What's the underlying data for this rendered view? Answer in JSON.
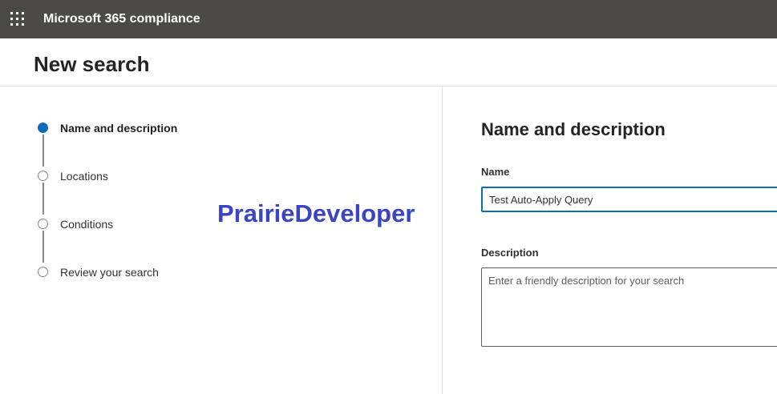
{
  "header": {
    "app_title": "Microsoft 365 compliance",
    "app_launcher_icon": "waffle-icon",
    "background_color": "#4b4a48"
  },
  "page": {
    "title": "New search"
  },
  "wizard": {
    "active_color": "#0f6cbd",
    "steps": [
      {
        "label": "Name and description",
        "state": "active"
      },
      {
        "label": "Locations",
        "state": "pending"
      },
      {
        "label": "Conditions",
        "state": "pending"
      },
      {
        "label": "Review your search",
        "state": "pending"
      }
    ]
  },
  "watermark": {
    "text": "PrairieDeveloper",
    "color": "#3b45c4"
  },
  "form": {
    "heading": "Name and description",
    "name_label": "Name",
    "name_value": "Test Auto-Apply Query",
    "description_label": "Description",
    "description_placeholder": "Enter a friendly description for your search"
  }
}
